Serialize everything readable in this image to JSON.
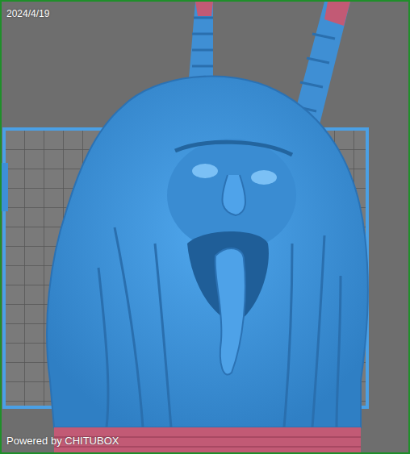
{
  "viewport": {
    "date": "2024/4/19",
    "brand": "Powered by CHITUBOX"
  }
}
